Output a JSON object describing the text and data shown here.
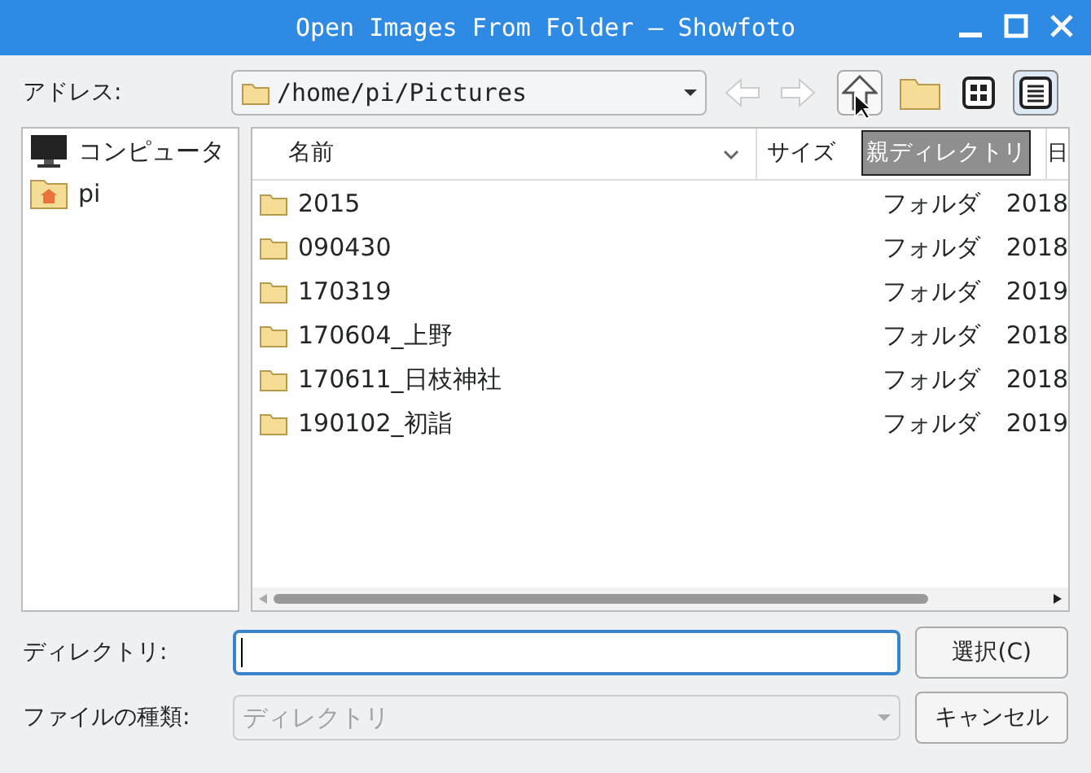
{
  "window": {
    "title": "Open Images From Folder — Showfoto"
  },
  "address": {
    "label": "アドレス:",
    "value": "/home/pi/Pictures"
  },
  "toolbar": {
    "tooltip": "親ディレクトリ"
  },
  "sidebar": {
    "items": [
      {
        "kind": "computer",
        "label": "コンピュータ"
      },
      {
        "kind": "home",
        "label": "pi"
      }
    ]
  },
  "table": {
    "columns": [
      "名前",
      "サイズ",
      "日"
    ],
    "rows": [
      {
        "name": "2015",
        "type": "フォルダ",
        "date": "2018"
      },
      {
        "name": "090430",
        "type": "フォルダ",
        "date": "2018"
      },
      {
        "name": "170319",
        "type": "フォルダ",
        "date": "2019"
      },
      {
        "name": "170604_上野",
        "type": "フォルダ",
        "date": "2018"
      },
      {
        "name": "170611_日枝神社",
        "type": "フォルダ",
        "date": "2018"
      },
      {
        "name": "190102_初詣",
        "type": "フォルダ",
        "date": "2019"
      }
    ]
  },
  "directory": {
    "label": "ディレクトリ:"
  },
  "filetype": {
    "label": "ファイルの種類:",
    "value": "ディレクトリ",
    "disabled": true
  },
  "buttons": [
    "選択(C)",
    "キャンセル"
  ]
}
